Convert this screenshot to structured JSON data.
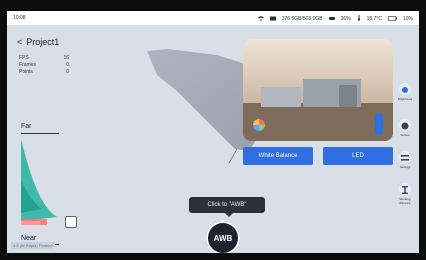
{
  "status_bar": {
    "time": "10:08",
    "storage": "376.6GB/503.0GB",
    "memory": "36%",
    "temperature": "18.7°C",
    "battery": "10%"
  },
  "project": {
    "back_symbol": "<",
    "title": "Project1"
  },
  "stats": [
    {
      "label": "FPS",
      "value": "16"
    },
    {
      "label": "Frames",
      "value": "0"
    },
    {
      "label": "Points",
      "value": "0"
    }
  ],
  "depth": {
    "far_label": "Far",
    "near_label": "Near"
  },
  "bottom_label": "1.5 (W Rapid) Feature",
  "preview_buttons": {
    "white_balance": "White Balance",
    "led": "LED"
  },
  "hint": {
    "text": "Click to \"AWB\""
  },
  "awb_button": {
    "label": "AWB"
  },
  "sidebar": {
    "items": [
      {
        "label": "Brightness",
        "icon": "brightness-icon"
      },
      {
        "label": "Texture",
        "icon": "texture-icon"
      },
      {
        "label": "Settings",
        "icon": "settings-icon"
      },
      {
        "label": "Working distance",
        "icon": "working-distance-icon"
      }
    ]
  },
  "colors": {
    "accent": "#2f6fe3",
    "dark": "#1e2331"
  }
}
